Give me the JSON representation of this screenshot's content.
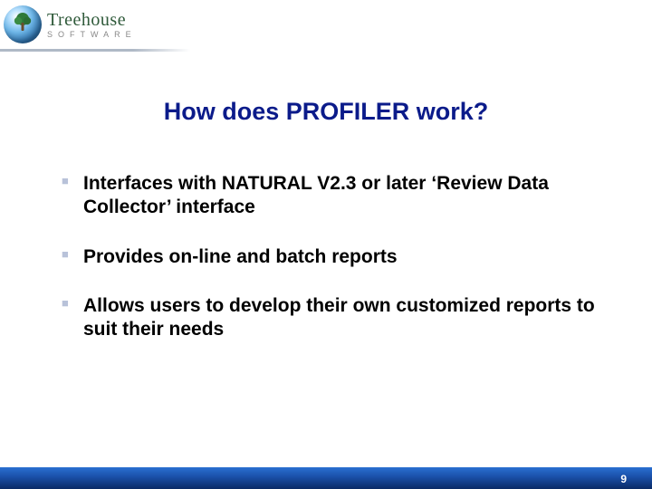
{
  "logo": {
    "brand": "Treehouse",
    "sub": "SOFTWARE",
    "icon_name": "tree-globe-icon"
  },
  "title": "How does PROFILER work?",
  "bullets": [
    "Interfaces with NATURAL V2.3 or later ‘Review Data Collector’ interface",
    "Provides on-line and batch reports",
    "Allows users to develop their own customized reports to suit their needs"
  ],
  "pageNumber": "9"
}
